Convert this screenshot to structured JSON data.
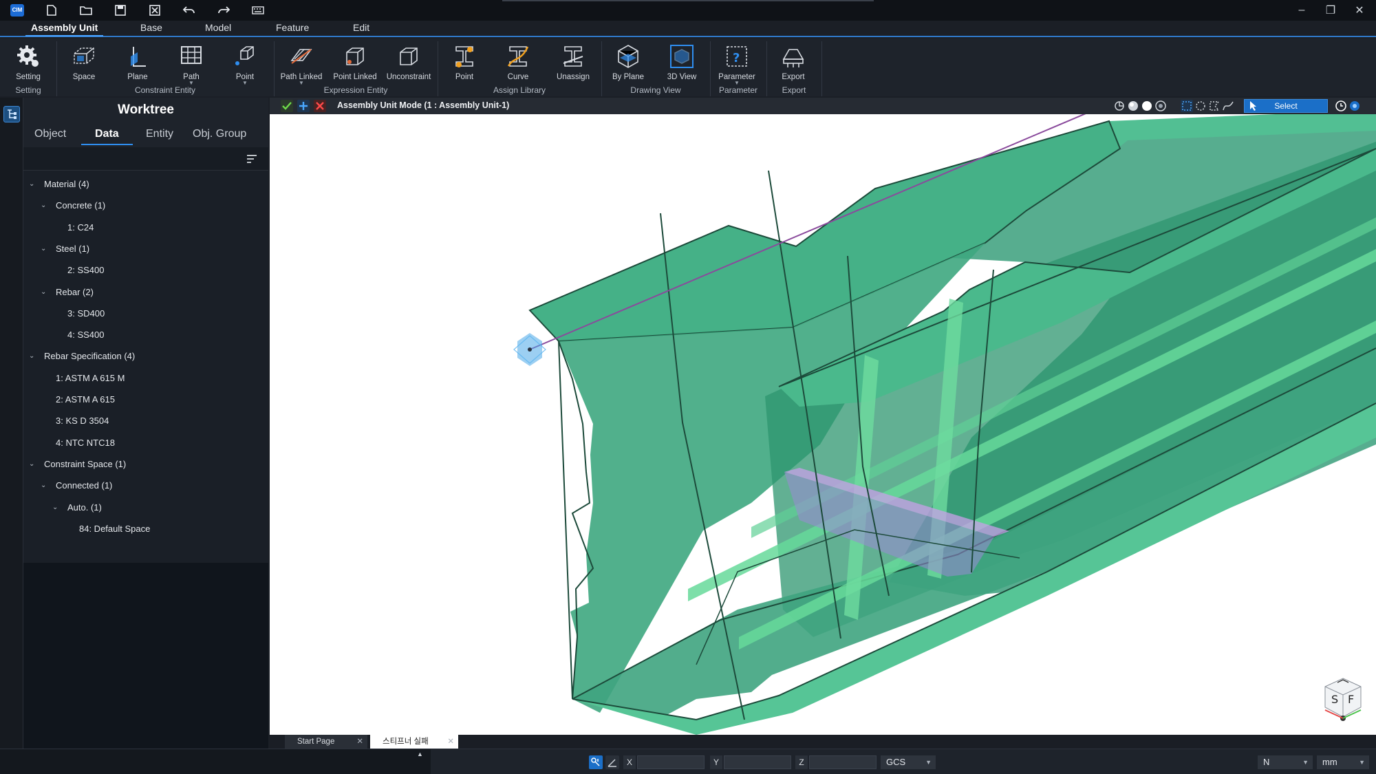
{
  "window": {
    "app_logo_text": "CIM",
    "controls": [
      "–",
      "❐",
      "✕"
    ]
  },
  "menu": {
    "tabs": [
      {
        "label": "Assembly Unit",
        "active": true
      },
      {
        "label": "Base"
      },
      {
        "label": "Model"
      },
      {
        "label": "Feature"
      },
      {
        "label": "Edit"
      }
    ]
  },
  "ribbon": {
    "buttons": [
      {
        "label": "Setting",
        "icon": "gear-icon"
      },
      {
        "label": "Space",
        "icon": "space-box-icon"
      },
      {
        "label": "Plane",
        "icon": "plane-icon"
      },
      {
        "label": "Path",
        "icon": "path-grid-icon",
        "dropdown": true
      },
      {
        "label": "Point",
        "icon": "point-cube-icon",
        "dropdown": true
      },
      {
        "label": "Path Linked",
        "icon": "path-linked-icon",
        "dropdown": true
      },
      {
        "label": "Point Linked",
        "icon": "point-linked-icon"
      },
      {
        "label": "Unconstraint",
        "icon": "unconstraint-icon"
      },
      {
        "label": "Point",
        "icon": "assign-point-icon"
      },
      {
        "label": "Curve",
        "icon": "assign-curve-icon"
      },
      {
        "label": "Unassign",
        "icon": "unassign-icon"
      },
      {
        "label": "By Plane",
        "icon": "by-plane-icon"
      },
      {
        "label": "3D View",
        "icon": "3d-view-icon"
      },
      {
        "label": "Parameter",
        "icon": "parameter-icon",
        "dropdown": true
      },
      {
        "label": "Export",
        "icon": "export-icon"
      }
    ],
    "groups": [
      "Setting",
      "Constraint Entity",
      "Expression Entity",
      "Assign Library",
      "Drawing View",
      "Parameter",
      "Export"
    ]
  },
  "worktree": {
    "title": "Worktree",
    "tabs": [
      {
        "label": "Object"
      },
      {
        "label": "Data",
        "active": true
      },
      {
        "label": "Entity"
      },
      {
        "label": "Obj. Group"
      }
    ],
    "items": [
      {
        "label": "Material (4)",
        "level": 0,
        "expanded": true
      },
      {
        "label": "Concrete (1)",
        "level": 1,
        "expanded": true
      },
      {
        "label": "1: C24",
        "level": 2
      },
      {
        "label": "Steel (1)",
        "level": 1,
        "expanded": true
      },
      {
        "label": "2: SS400",
        "level": 2
      },
      {
        "label": "Rebar (2)",
        "level": 1,
        "expanded": true
      },
      {
        "label": "3: SD400",
        "level": 2
      },
      {
        "label": "4: SS400",
        "level": 2
      },
      {
        "label": "Rebar Specification (4)",
        "level": 0,
        "expanded": true
      },
      {
        "label": "1: ASTM A 615 M",
        "level": 1
      },
      {
        "label": "2: ASTM A 615",
        "level": 1
      },
      {
        "label": "3: KS D 3504",
        "level": 1
      },
      {
        "label": "4: NTC NTC18",
        "level": 1
      },
      {
        "label": "Constraint Space (1)",
        "level": 0,
        "expanded": true
      },
      {
        "label": "Connected (1)",
        "level": 1,
        "expanded": true
      },
      {
        "label": "Auto. (1)",
        "level": 2,
        "expanded": true
      },
      {
        "label": "84: Default Space",
        "level": 3
      }
    ]
  },
  "viewport": {
    "mode_title": "Assembly Unit Mode (1 : Assembly Unit-1)",
    "select_label": "Select",
    "nav_cube": {
      "left": "S",
      "right": "F"
    },
    "colors": {
      "concrete": "#2e9e74",
      "edge": "#1c4a3a",
      "path": "#8a4a9c",
      "accent": "#1b6fc8"
    }
  },
  "doc_tabs": [
    {
      "label": "Start Page",
      "active": false
    },
    {
      "label": "스티프너 실패",
      "active": true
    }
  ],
  "statusbar": {
    "x_label": "X",
    "y_label": "Y",
    "z_label": "Z",
    "x_value": "",
    "y_value": "",
    "z_value": "",
    "coord_system": "GCS",
    "force_unit": "N",
    "length_unit": "mm"
  }
}
